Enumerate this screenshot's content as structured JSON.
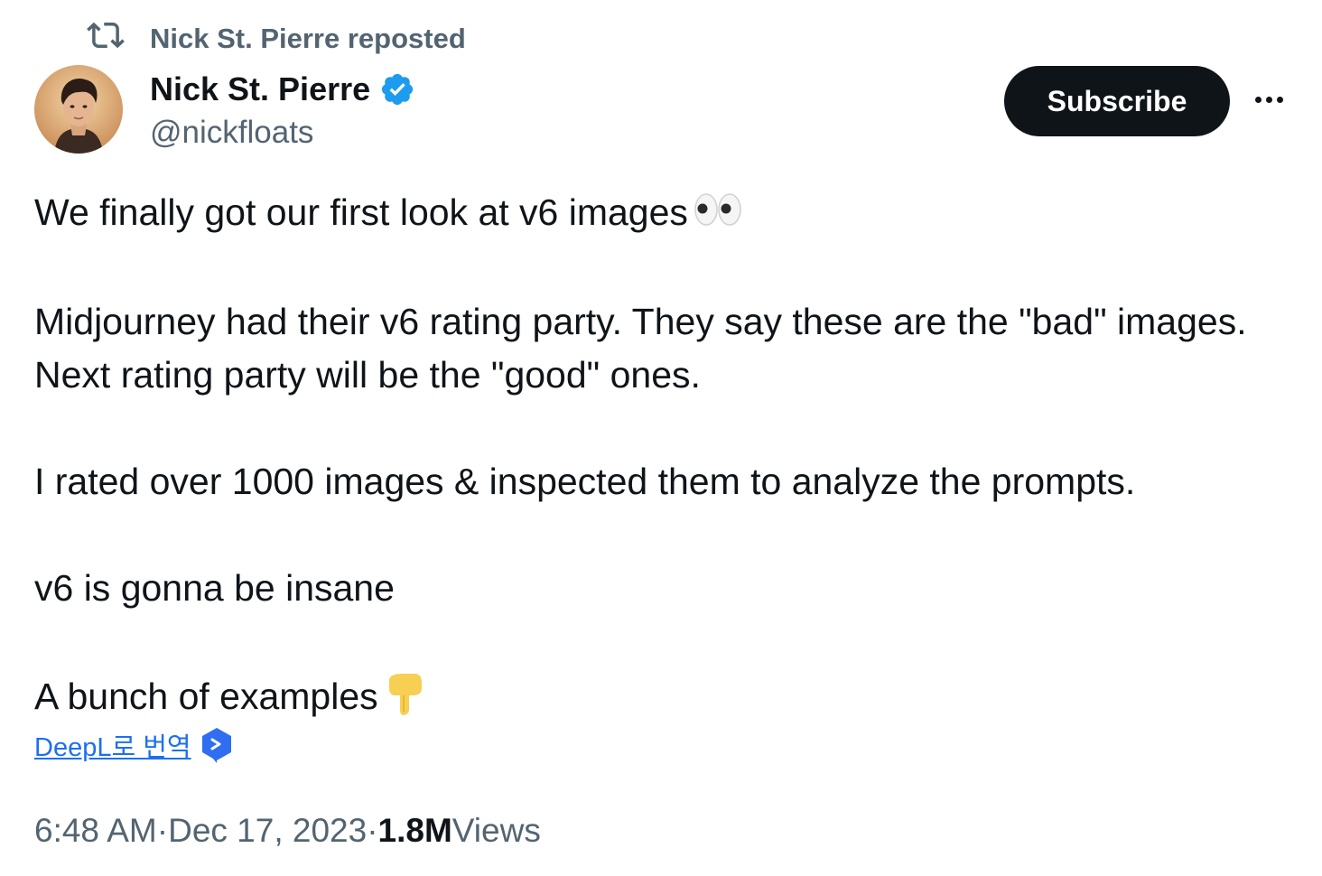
{
  "repost": {
    "icon": "repost-icon",
    "text": "Nick St. Pierre reposted"
  },
  "author": {
    "display_name": "Nick St. Pierre",
    "handle": "@nickfloats",
    "verified": true,
    "verified_color": "#1d9bf0"
  },
  "actions": {
    "subscribe_label": "Subscribe",
    "more_icon": "more-dots-icon"
  },
  "tweet": {
    "line1": "We finally got our first look at v6 images",
    "line1_emoji": "eyes-emoji",
    "para2": "Midjourney had their v6 rating party. They say these are the \"bad\" images. Next rating party will be the \"good\" ones.",
    "para3": "I rated over 1000 images & inspected them to analyze the prompts.",
    "para4": "v6 is gonna be insane",
    "para5": "A bunch of examples",
    "para5_emoji": "pointing-down-emoji"
  },
  "translate": {
    "link_text": "DeepL로 번역",
    "icon": "deepl-icon"
  },
  "meta": {
    "time": "6:48 AM",
    "separator": "·",
    "date": "Dec 17, 2023",
    "views_count": "1.8M",
    "views_label": "Views"
  },
  "colors": {
    "text_primary": "#0f1419",
    "text_secondary": "#536471",
    "link": "#1d6ff2",
    "button_bg": "#0f1419"
  }
}
